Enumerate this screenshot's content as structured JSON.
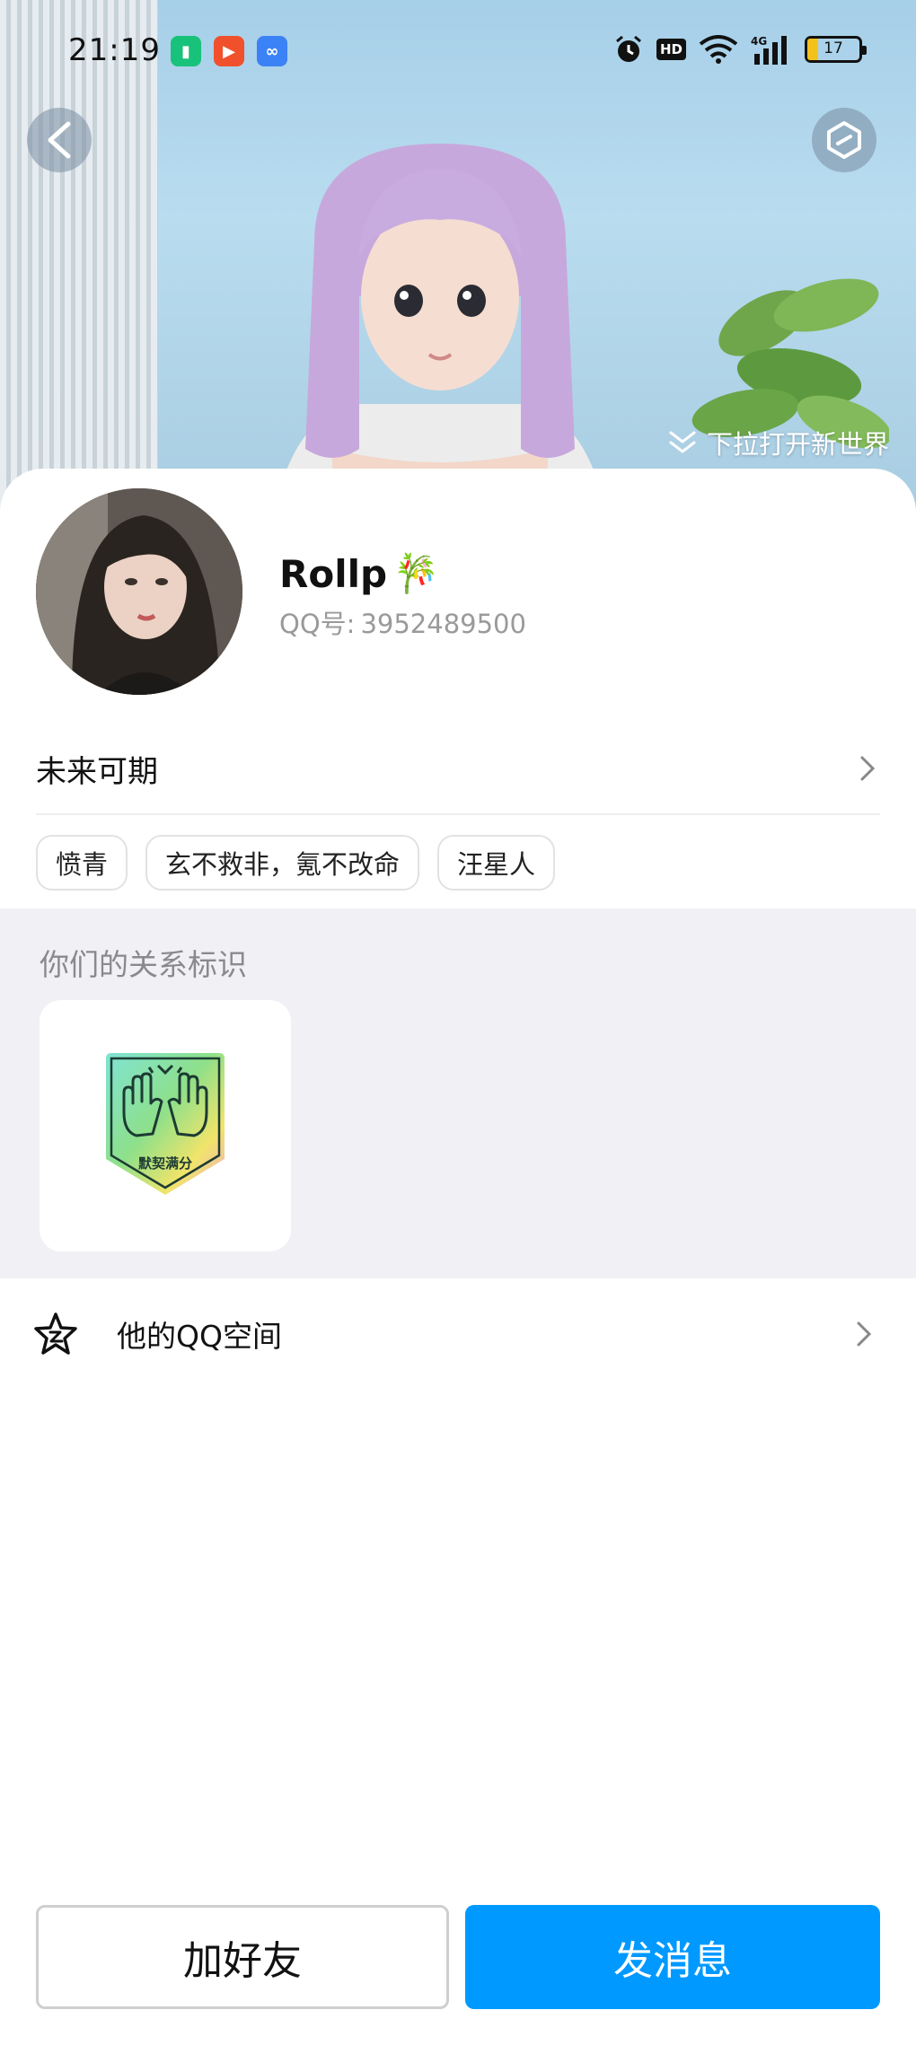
{
  "status_bar": {
    "time": "21:19",
    "hd": "HD",
    "network": "4G",
    "battery": "17"
  },
  "banner": {
    "pull_hint": "下拉打开新世界"
  },
  "profile": {
    "nickname": "Rollp",
    "nickname_emoji": "🎋",
    "qq_label": "QQ号:",
    "qq_number": "3952489500",
    "signature": "未来可期",
    "tags": [
      "愤青",
      "玄不救非，氪不改命",
      "汪星人"
    ]
  },
  "relation": {
    "title": "你们的关系标识",
    "badge_label": "默契满分"
  },
  "zone": {
    "label": "他的QQ空间"
  },
  "actions": {
    "add_friend": "加好友",
    "send_message": "发消息"
  },
  "colors": {
    "primary": "#0099ff",
    "muted_text": "#9a9a9a",
    "section_bg": "#f1f1f5"
  }
}
